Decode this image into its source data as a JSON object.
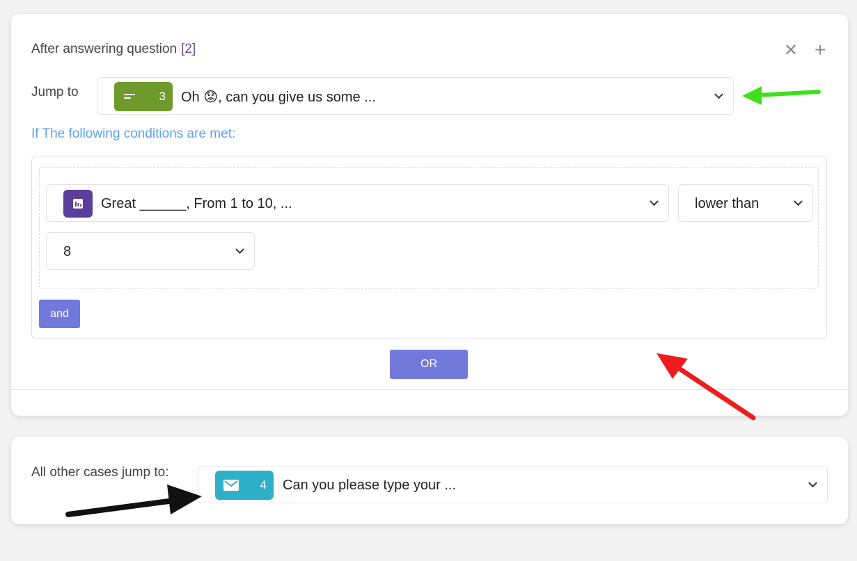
{
  "rule": {
    "header_prefix": "After answering question",
    "question_ref": "[2]",
    "jump_label": "Jump to",
    "jump_target": {
      "number": "3",
      "text": "Oh 😟, can you give us some ...",
      "badge_color": "#6e9a2c",
      "icon": "short-text-icon"
    },
    "conditions_title": "If The following conditions are met:",
    "condition": {
      "question": {
        "text": "Great ______, From 1 to 10, ...",
        "badge_color": "#5b3e99",
        "icon": "rating-chart-icon"
      },
      "operator": "lower than",
      "value": "8"
    },
    "and_label": "and",
    "or_label": "OR"
  },
  "fallback": {
    "label": "All other cases jump to:",
    "target": {
      "number": "4",
      "text": "Can you please type your ...",
      "badge_color": "#2eb0c9",
      "icon": "email-icon"
    }
  },
  "colors": {
    "accent_button": "#7379dc",
    "link_blue": "#5aa2ef",
    "question_ref": "#6b4ea0"
  }
}
